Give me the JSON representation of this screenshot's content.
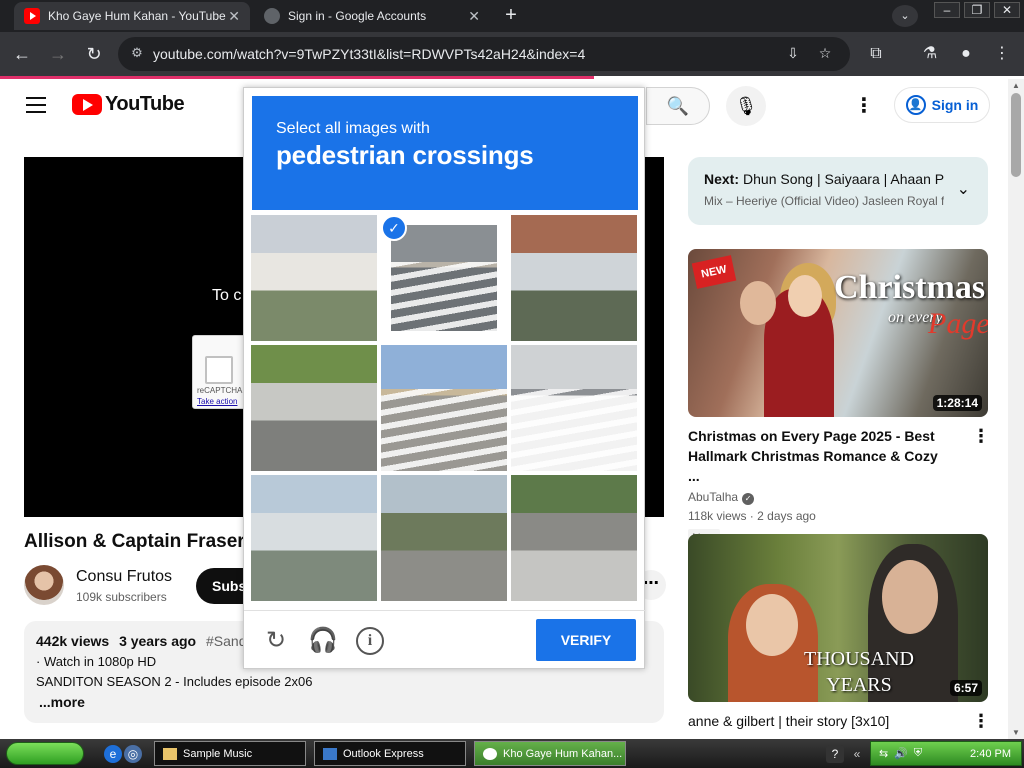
{
  "browser": {
    "tabs": [
      {
        "title": "Kho Gaye Hum Kahan - YouTube",
        "active": true,
        "icon": "youtube-icon"
      },
      {
        "title": "Sign in - Google Accounts",
        "active": false,
        "icon": "globe-icon"
      }
    ],
    "close_glyph": "✕",
    "new_tab_glyph": "+",
    "url": "youtube.com/watch?v=9TwPZYt33tI&list=RDWVPTs42aH24&index=4",
    "load_progress_percent": 58
  },
  "youtube": {
    "logo_text": "YouTube",
    "sign_in_label": "Sign in",
    "player_message": "To c",
    "mini_captcha": {
      "label": "reCAPTCHA",
      "link": "Take action"
    },
    "video_title": "Allison & Captain Fraser",
    "channel": {
      "name": "Consu Frutos",
      "subscribers": "109k subscribers"
    },
    "subscribe_label": "Subs",
    "description": {
      "views": "442k views",
      "age": "3 years ago",
      "tag": "#Sandito",
      "line1": "· Watch in 1080p HD",
      "line2": "SANDITON SEASON 2 - Includes episode 2x06",
      "more": "...more"
    },
    "next_card": {
      "label": "Next:",
      "title": "Dhun Song | Saiyaara | Ahaan Panday, Aneet",
      "subtitle": "Mix – Heeriye (Official Video) Jasleen Royal ft Arijit"
    },
    "recommendations": [
      {
        "thumb_title": "Christmas",
        "thumb_sub": "on every",
        "thumb_word": "Page",
        "thumb_badge": "NEW",
        "duration": "1:28:14",
        "title": "Christmas on Every Page 2025 - Best Hallmark Christmas Romance & Cozy ...",
        "channel": "AbuTalha",
        "meta": "118k views · 2 days ago",
        "badge": "New"
      },
      {
        "thumb_title": "THOUSAND YEARS",
        "duration": "6:57",
        "title": "anne & gilbert | their story [3x10]"
      }
    ]
  },
  "captcha": {
    "instruction_small": "Select all images with",
    "instruction_big": "pedestrian crossings",
    "verify_label": "VERIFY",
    "selected_tiles": [
      1
    ],
    "tiles": [
      {
        "scene": "street-buildings",
        "colors": [
          "#c9cfd6",
          "#e8e6e1",
          "#7b8a6a"
        ]
      },
      {
        "scene": "crosswalk-road",
        "colors": [
          "#8a8f93",
          "#b9b3a8",
          "#6d7276"
        ]
      },
      {
        "scene": "city-traffic",
        "colors": [
          "#a56a52",
          "#cfd4d8",
          "#5e6a55"
        ]
      },
      {
        "scene": "intersection-trees",
        "colors": [
          "#6f8f4a",
          "#c7c8c4",
          "#7e7f7c"
        ]
      },
      {
        "scene": "crosswalk-paint",
        "colors": [
          "#8fb0d8",
          "#c8b89a",
          "#9a9893"
        ]
      },
      {
        "scene": "zebra-crossing",
        "colors": [
          "#cfd2d4",
          "#8d9094",
          "#f2f2f2"
        ]
      },
      {
        "scene": "narrow-street",
        "colors": [
          "#b8c9d8",
          "#d8dde0",
          "#7e8a7c"
        ]
      },
      {
        "scene": "bus-stop",
        "colors": [
          "#b2c0ca",
          "#6d7a5c",
          "#8d8d88"
        ]
      },
      {
        "scene": "motorbikes-road",
        "colors": [
          "#5d7a4a",
          "#8a8a86",
          "#c5c5c2"
        ]
      }
    ]
  },
  "taskbar": {
    "items": [
      {
        "label": "Sample Music",
        "active": false
      },
      {
        "label": "Outlook Express",
        "active": false
      },
      {
        "label": "Kho Gaye Hum Kahan...",
        "active": true
      }
    ],
    "clock": "2:40 PM"
  },
  "colors": {
    "yt_red": "#ff0000",
    "captcha_blue": "#1a73e8",
    "sign_in_blue": "#065fd4",
    "load_bar": "#e0306a"
  }
}
